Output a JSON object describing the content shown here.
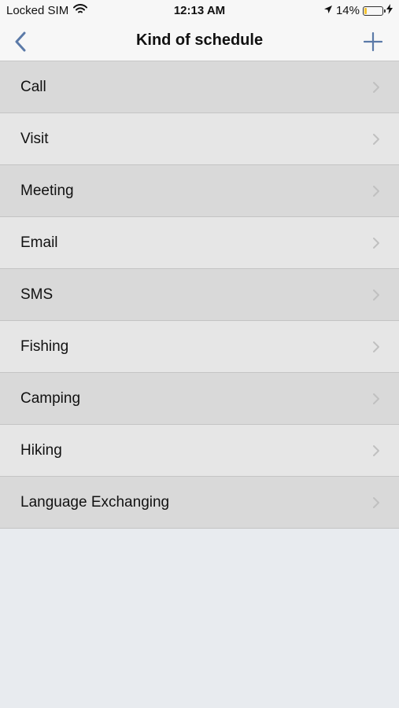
{
  "status_bar": {
    "carrier": "Locked SIM",
    "time": "12:13 AM",
    "battery_percent": "14%",
    "battery_level": 0.14,
    "icons": [
      "wifi-icon",
      "location-arrow-icon",
      "battery-icon",
      "charging-bolt-icon"
    ]
  },
  "nav": {
    "title": "Kind of schedule",
    "back_icon": "chevron-left-icon",
    "add_icon": "plus-icon",
    "accent_color": "#5b7aa8"
  },
  "items": [
    {
      "label": "Call"
    },
    {
      "label": "Visit"
    },
    {
      "label": "Meeting"
    },
    {
      "label": "Email"
    },
    {
      "label": "SMS"
    },
    {
      "label": "Fishing"
    },
    {
      "label": "Camping"
    },
    {
      "label": "Hiking"
    },
    {
      "label": "Language Exchanging"
    }
  ]
}
